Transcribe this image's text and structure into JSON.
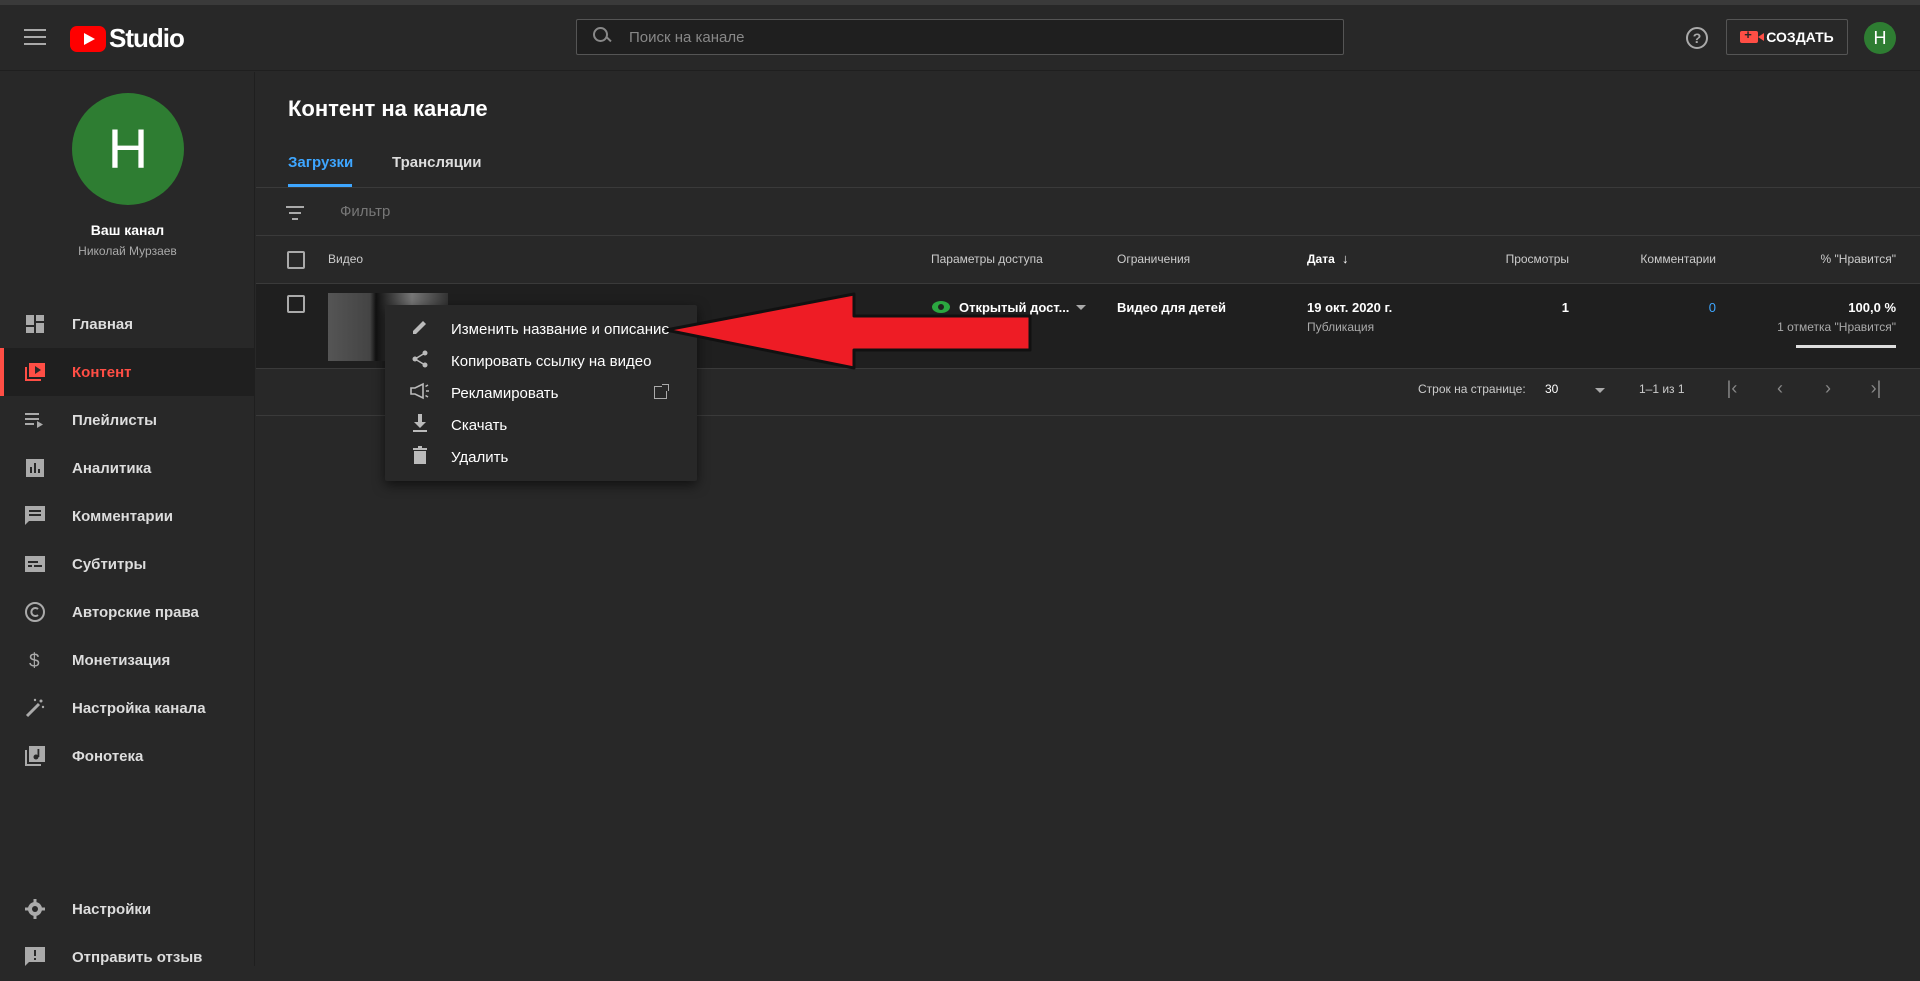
{
  "header": {
    "logo_text": "Studio",
    "search_placeholder": "Поиск на канале",
    "help_glyph": "?",
    "create_label": "СОЗДАТЬ",
    "avatar_letter": "H"
  },
  "sidebar": {
    "avatar_letter": "H",
    "channel_title": "Ваш канал",
    "channel_owner": "Николай Мурзаев",
    "items": [
      {
        "label": "Главная",
        "icon": "dashboard-icon"
      },
      {
        "label": "Контент",
        "icon": "content-icon",
        "active": true
      },
      {
        "label": "Плейлисты",
        "icon": "playlist-icon"
      },
      {
        "label": "Аналитика",
        "icon": "analytics-icon"
      },
      {
        "label": "Комментарии",
        "icon": "comments-icon"
      },
      {
        "label": "Субтитры",
        "icon": "subtitles-icon"
      },
      {
        "label": "Авторские права",
        "icon": "copyright-icon"
      },
      {
        "label": "Монетизация",
        "icon": "dollar-icon"
      },
      {
        "label": "Настройка канала",
        "icon": "magic-wand-icon"
      },
      {
        "label": "Фонотека",
        "icon": "audio-library-icon"
      }
    ],
    "bottom": [
      {
        "label": "Настройки",
        "icon": "gear-icon"
      },
      {
        "label": "Отправить отзыв",
        "icon": "feedback-icon"
      }
    ]
  },
  "main": {
    "title": "Контент на канале",
    "tabs": [
      {
        "label": "Загрузки",
        "active": true
      },
      {
        "label": "Трансляции",
        "active": false
      }
    ],
    "filter_placeholder": "Фильтр",
    "columns": {
      "video": "Видео",
      "visibility": "Параметры доступа",
      "restrictions": "Ограничения",
      "date": "Дата",
      "views": "Просмотры",
      "comments": "Комментарии",
      "likes": "% \"Нравится\""
    },
    "rows": [
      {
        "visibility": "Открытый дост...",
        "restrictions": "Видео для детей",
        "date": "19 окт. 2020 г.",
        "date_sub": "Публикация",
        "views": "1",
        "comments": "0",
        "likes": "100,0 %",
        "likes_sub": "1 отметка \"Нравится\""
      }
    ],
    "pager": {
      "rows_label": "Строк на странице:",
      "rows_value": "30",
      "range": "1–1 из 1"
    }
  },
  "context_menu": {
    "items": [
      {
        "label": "Изменить название и описание",
        "icon": "pencil-icon"
      },
      {
        "label": "Копировать ссылку на видео",
        "icon": "share-icon"
      },
      {
        "label": "Рекламировать",
        "icon": "megaphone-icon"
      },
      {
        "label": "Скачать",
        "icon": "download-icon"
      },
      {
        "label": "Удалить",
        "icon": "trash-icon"
      }
    ]
  },
  "colors": {
    "accent_blue": "#3ea6ff",
    "brand_red": "#ff0000",
    "active_red": "#ff4e45",
    "public_green": "#2ba640",
    "avatar_green": "#2e7d32",
    "annotation_arrow": "#ee1c25"
  }
}
